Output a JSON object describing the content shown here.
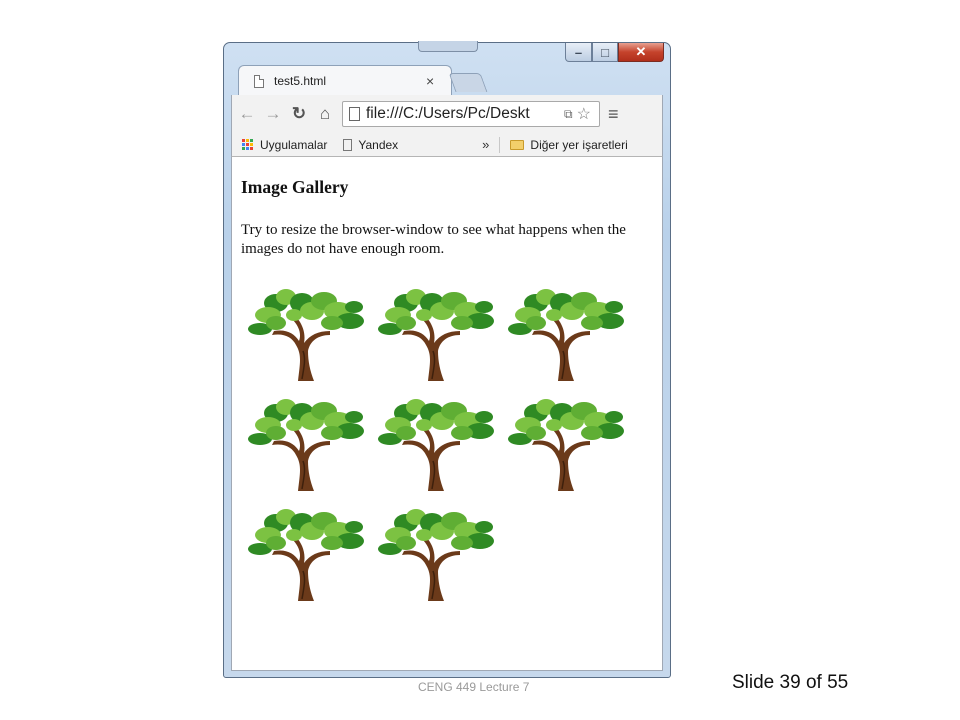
{
  "browser": {
    "tab_title": "test5.html",
    "tab_close": "×",
    "address": "file:///C:/Users/Pc/Deskt",
    "bookmarks": {
      "apps_label": "Uygulamalar",
      "item_label": "Yandex",
      "overflow": "»",
      "other_bookmarks": "Diğer yer işaretleri"
    },
    "nav_icons": [
      "back-icon",
      "forward-icon",
      "reload-icon",
      "home-icon",
      "star-icon",
      "menu-icon"
    ]
  },
  "page": {
    "heading": "Image Gallery",
    "paragraph": "Try to resize the browser-window to see what happens when the images do not have enough room.",
    "image_count": 8,
    "image_icon": "tree-image"
  },
  "slide": {
    "footer": "CENG 449 Lecture 7",
    "number": "Slide 39 of 55"
  },
  "colors": {
    "leaf_light": "#7cc242",
    "leaf_dark": "#2f8a24",
    "trunk": "#6b3a1a",
    "close_button": "#c5432c"
  }
}
